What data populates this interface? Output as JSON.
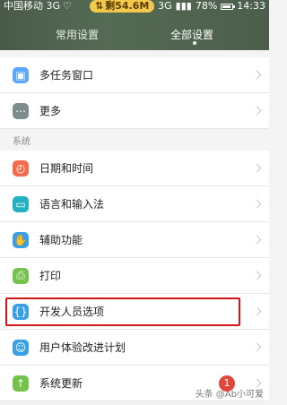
{
  "status_bar": {
    "carrier": "中国移动 3G",
    "data_remaining": "剩54.6M",
    "network": "3G",
    "battery": "78%",
    "time": "14:33"
  },
  "tabs": [
    {
      "label": "常用设置"
    },
    {
      "label": "全部设置"
    }
  ],
  "items_top": [
    {
      "label": "多任务窗口",
      "icon": "multi-window-icon",
      "color": "#58a6ff"
    },
    {
      "label": "更多",
      "icon": "more-icon",
      "color": "#7f8c8d"
    }
  ],
  "section_title": "系统",
  "items_system": [
    {
      "label": "日期和时间",
      "icon": "clock-icon",
      "color": "#f26b4f"
    },
    {
      "label": "语言和输入法",
      "icon": "keyboard-icon",
      "color": "#22b2c2"
    },
    {
      "label": "辅助功能",
      "icon": "hand-icon",
      "color": "#3aa0e6"
    },
    {
      "label": "打印",
      "icon": "printer-icon",
      "color": "#74c14b"
    },
    {
      "label": "开发人员选项",
      "icon": "braces-icon",
      "color": "#3aa0e6"
    },
    {
      "label": "用户体验改进计划",
      "icon": "user-experience-icon",
      "color": "#3aa0e6"
    },
    {
      "label": "系统更新",
      "icon": "upgrade-icon",
      "color": "#74c14b",
      "badge": "1"
    }
  ],
  "watermark": "头条 @Ab小可爱"
}
